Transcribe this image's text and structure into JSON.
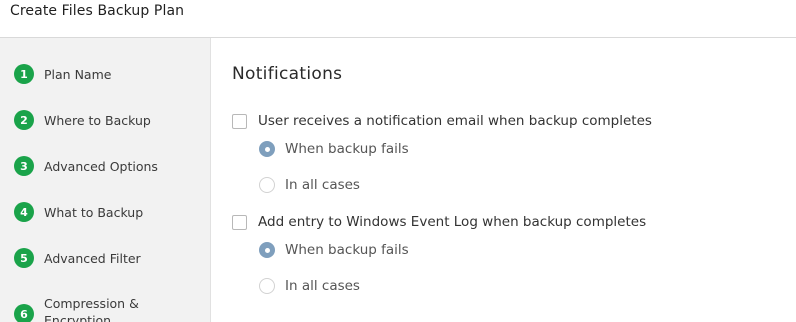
{
  "window": {
    "title": "Create Files Backup Plan"
  },
  "sidebar": {
    "steps": [
      {
        "number": "1",
        "label": "Plan Name"
      },
      {
        "number": "2",
        "label": "Where to Backup"
      },
      {
        "number": "3",
        "label": "Advanced Options"
      },
      {
        "number": "4",
        "label": "What to Backup"
      },
      {
        "number": "5",
        "label": "Advanced Filter"
      },
      {
        "number": "6",
        "label": "Compression & Encryption"
      }
    ],
    "step_color": "#1aa34a"
  },
  "main": {
    "heading": "Notifications",
    "groups": [
      {
        "checkbox_label": "User receives a notification email when backup completes",
        "checked": false,
        "options": [
          {
            "label": "When backup fails",
            "selected": true
          },
          {
            "label": "In all cases",
            "selected": false
          }
        ]
      },
      {
        "checkbox_label": "Add entry to Windows Event Log when backup completes",
        "checked": false,
        "options": [
          {
            "label": "When backup fails",
            "selected": true
          },
          {
            "label": "In all cases",
            "selected": false
          }
        ]
      }
    ],
    "radio_selected_color": "#7f9fbd"
  }
}
